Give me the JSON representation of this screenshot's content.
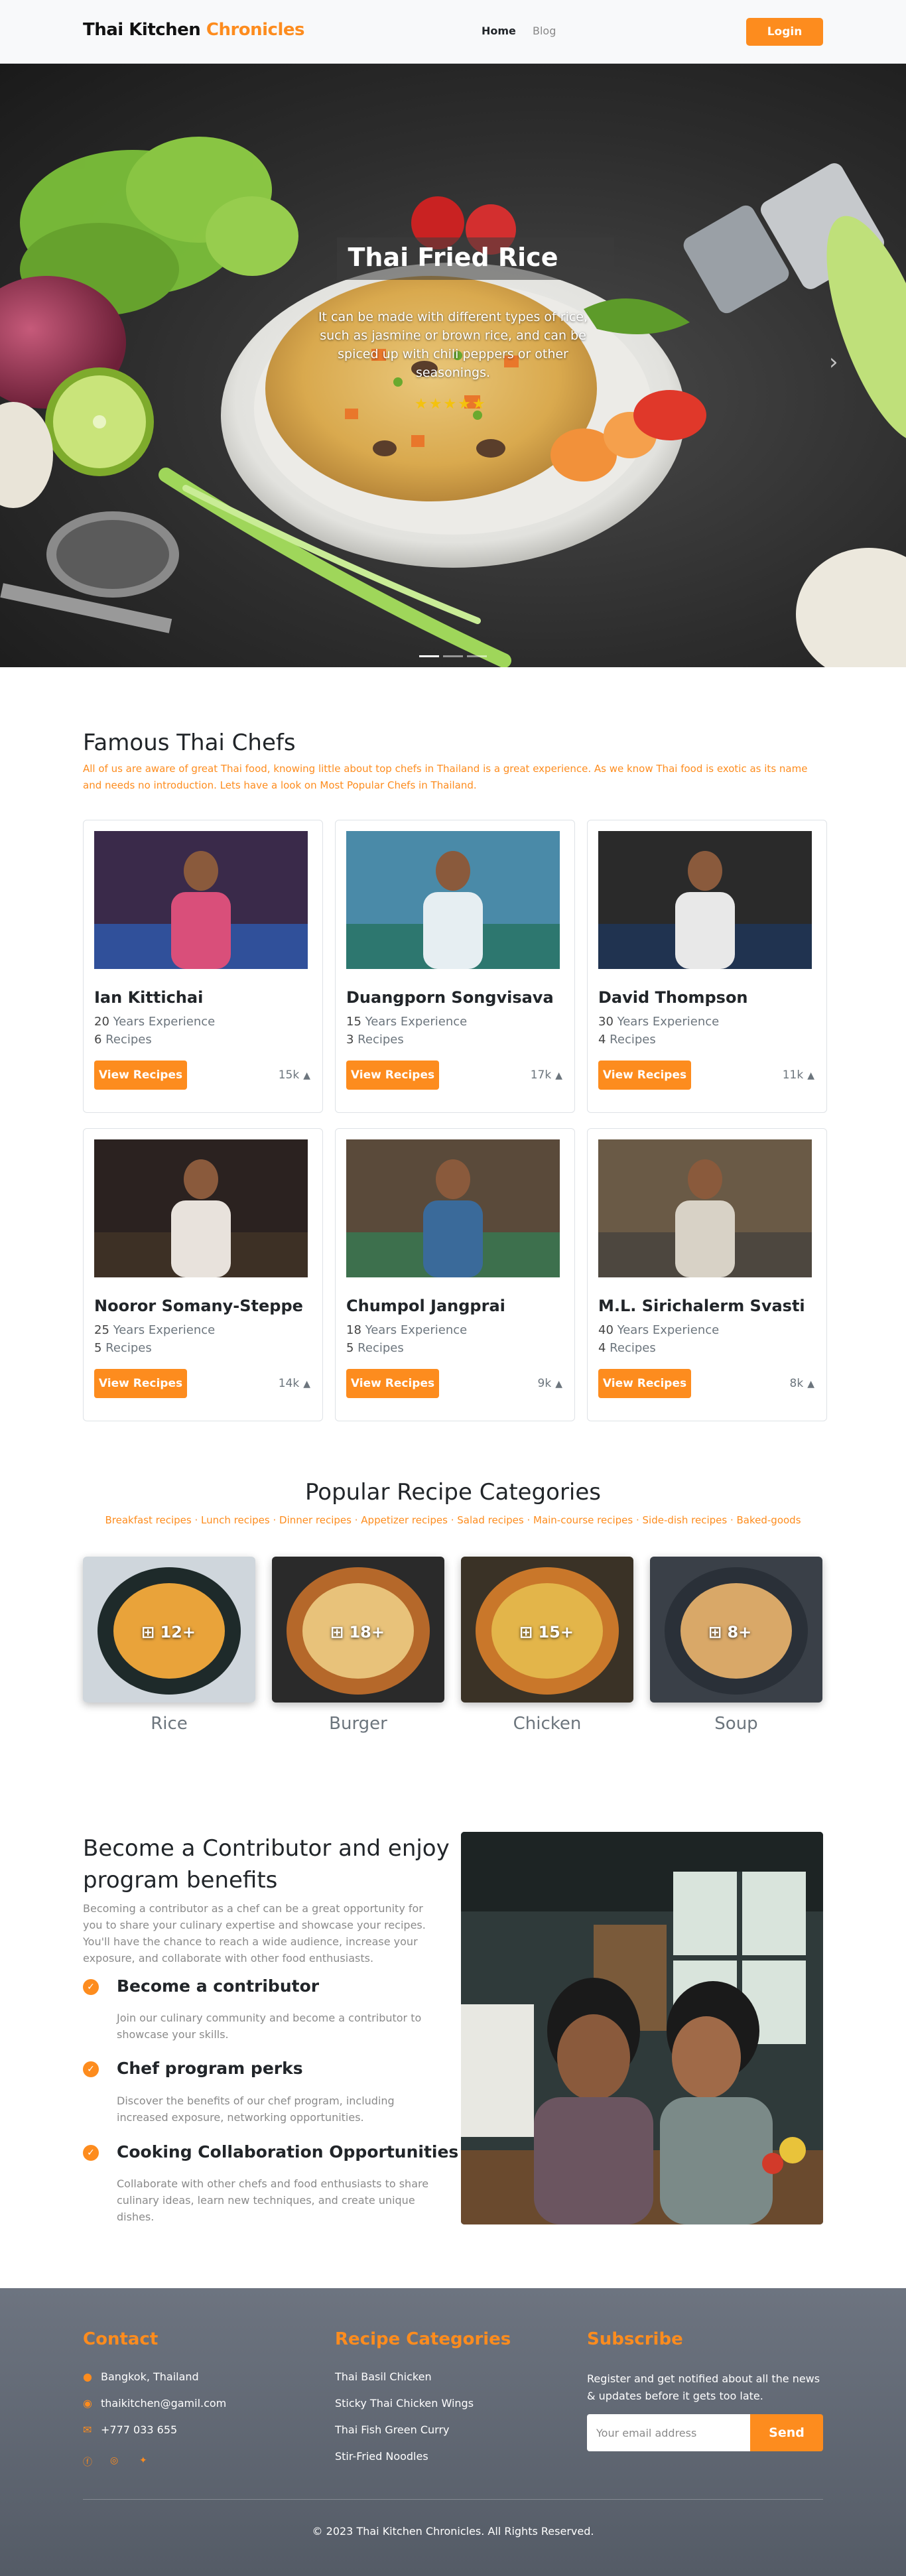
{
  "nav": {
    "brand_main": "Thai Kitchen ",
    "brand_accent": "Chronicles",
    "links": [
      "Home",
      "Blog"
    ],
    "login_label": "Login"
  },
  "hero": {
    "title": "Thai Fried Rice",
    "description": "It can be made with different types of rice, such as jasmine or brown rice, and can be spiced up with chili peppers or other seasonings.",
    "rating": 5,
    "stars": "★★★★★",
    "next_icon": "chevron-right-icon"
  },
  "chefs": {
    "title": "Famous Thai Chefs",
    "subtitle": "All of us are aware of great Thai food, knowing little about top chefs in Thailand is a great experience. As we know Thai food is exotic as its name and needs no introduction. Lets have a look on Most Popular Chefs in Thailand.",
    "years_suffix": " Years Experience",
    "recipes_suffix": " Recipes",
    "button_label": "View Recipes",
    "items": [
      {
        "name": "Ian Kittichai",
        "years": "20",
        "recipes": "6",
        "likes": "15k"
      },
      {
        "name": "Duangporn Songvisava",
        "years": "15",
        "recipes": "3",
        "likes": "17k"
      },
      {
        "name": "David Thompson",
        "years": "30",
        "recipes": "4",
        "likes": "11k"
      },
      {
        "name": "Nooror Somany-Steppe",
        "years": "25",
        "recipes": "5",
        "likes": "14k"
      },
      {
        "name": "Chumpol Jangprai",
        "years": "18",
        "recipes": "5",
        "likes": "9k"
      },
      {
        "name": "M.L. Sirichalerm Svasti",
        "years": "40",
        "recipes": "4",
        "likes": "8k"
      }
    ]
  },
  "categories": {
    "title": "Popular Recipe Categories",
    "links": [
      "Breakfast recipes",
      "Lunch recipes",
      "Dinner recipes",
      "Appetizer recipes",
      "Salad recipes",
      "Main-course recipes",
      "Side-dish recipes",
      "Baked-goods"
    ],
    "items": [
      {
        "name": "Rice",
        "count": "12+"
      },
      {
        "name": "Burger",
        "count": "18+"
      },
      {
        "name": "Chicken",
        "count": "15+"
      },
      {
        "name": "Soup",
        "count": "8+"
      }
    ]
  },
  "contributor": {
    "title": "Become a Contributor and enjoy program benefits",
    "intro": "Becoming a contributor as a chef can be a great opportunity for you to share your culinary expertise and showcase your recipes. You'll have the chance to reach a wide audience, increase your exposure, and collaborate with other food enthusiasts.",
    "benefits": [
      {
        "title": "Become a contributor",
        "desc": "Join our culinary community and become a contributor to showcase your skills."
      },
      {
        "title": "Chef program perks",
        "desc": "Discover the benefits of our chef program, including increased exposure, networking opportunities."
      },
      {
        "title": "Cooking Collaboration Opportunities",
        "desc": "Collaborate with other chefs and food enthusiasts to share culinary ideas, learn new techniques, and create unique dishes."
      }
    ]
  },
  "footer": {
    "contact_title": "Contact",
    "address": "Bangkok, Thailand",
    "email": "thaikitchen@gamil.com",
    "phone": "+777 033 655",
    "categories_title": "Recipe Categories",
    "category_links": [
      "Thai Basil Chicken",
      "Sticky Thai Chicken Wings",
      "Thai Fish Green Curry",
      "Stir-Fried Noodles"
    ],
    "subscribe_title": "Subscribe",
    "subscribe_text": "Register and get notified about all the news & updates before it gets too late.",
    "email_placeholder": "Your email address",
    "send_label": "Send",
    "copyright": "© 2023 Thai Kitchen Chronicles. All Rights Reserved.",
    "accent_color": "#fd8c1e"
  }
}
